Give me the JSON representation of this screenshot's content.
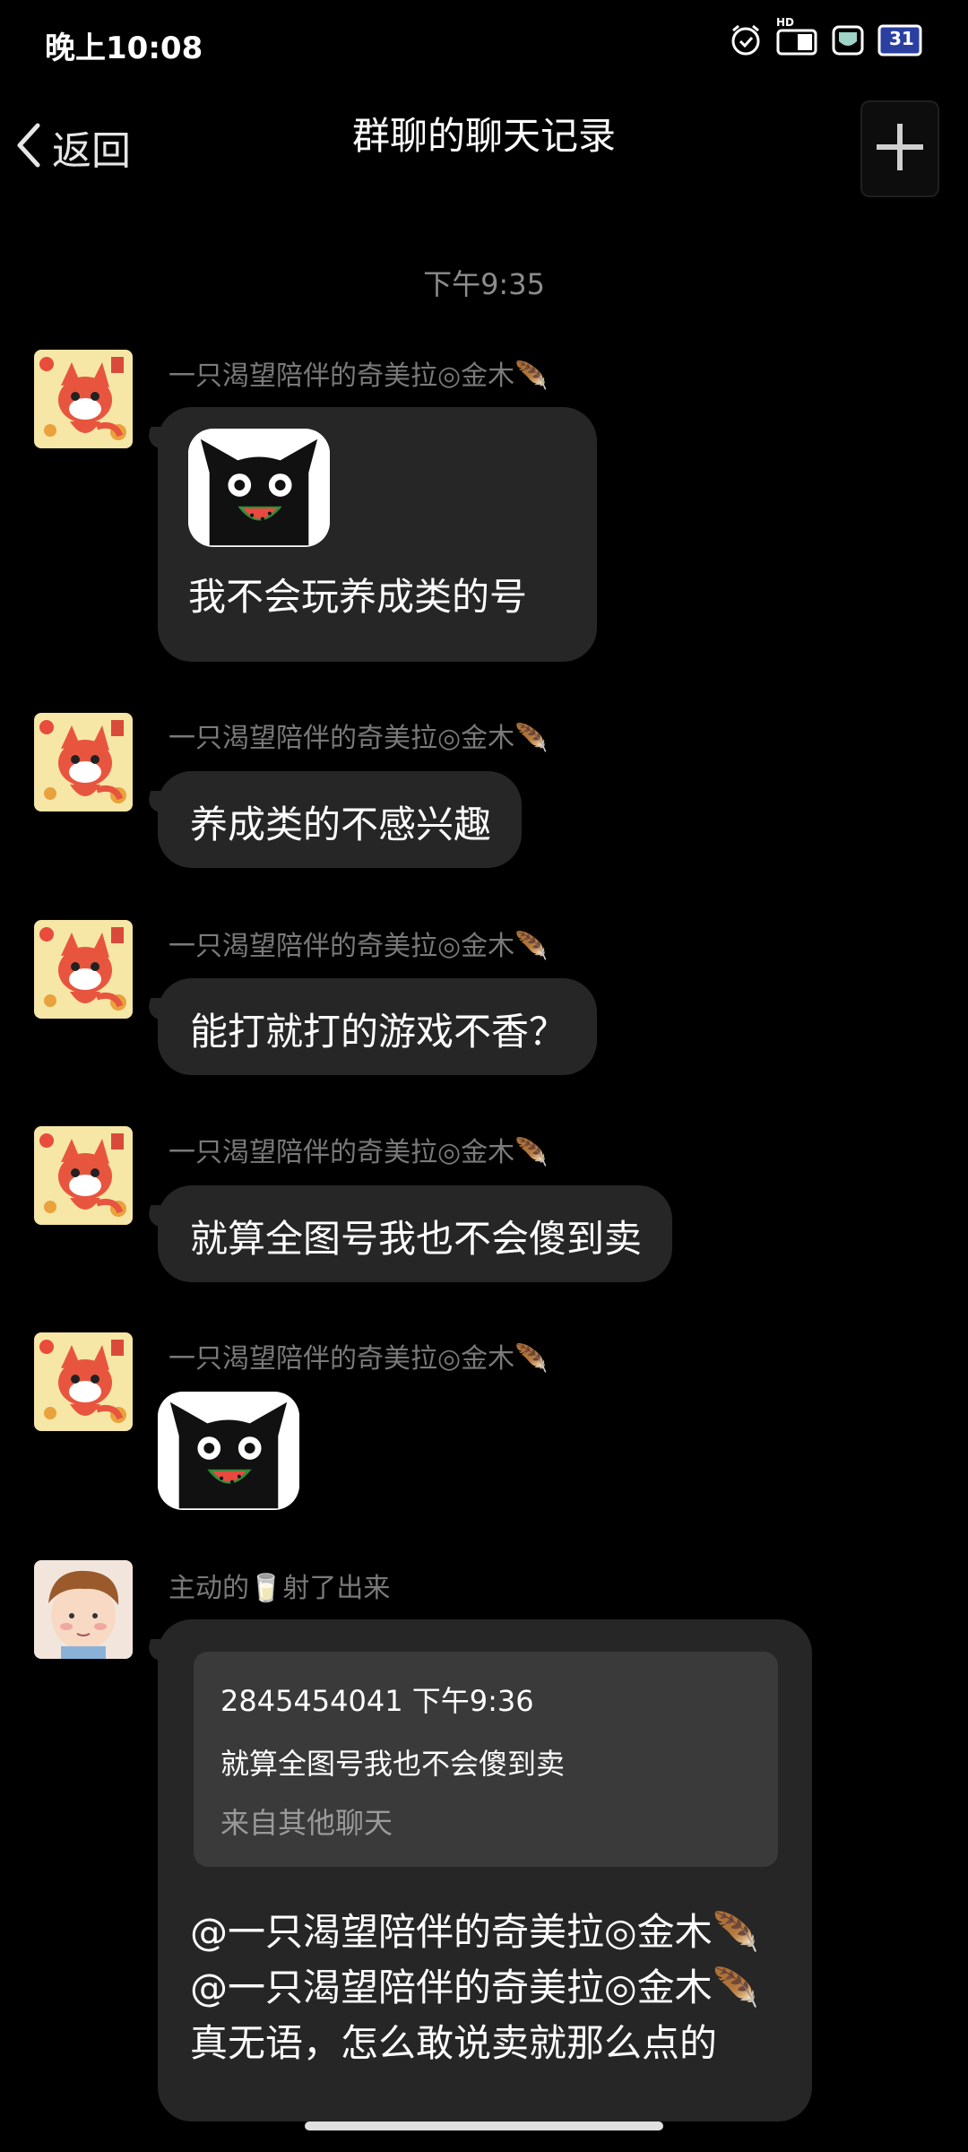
{
  "status_bar": {
    "time": "晚上10:08",
    "icons": [
      "alarm-icon",
      "hd-signal-icon",
      "shield-icon",
      "calendar-icon"
    ],
    "calendar_day": "31",
    "hd_label": "HD"
  },
  "header": {
    "back_label": "返回",
    "title": "群聊的聊天记录",
    "plus_icon": "plus-icon"
  },
  "timestamp": "下午9:35",
  "messages": [
    {
      "sender": "一只渴望陪伴的奇美拉◎金木🪶",
      "type": "sticker_text",
      "text": "我不会玩养成类的号"
    },
    {
      "sender": "一只渴望陪伴的奇美拉◎金木🪶",
      "type": "text",
      "text": "养成类的不感兴趣"
    },
    {
      "sender": "一只渴望陪伴的奇美拉◎金木🪶",
      "type": "text",
      "text": "能打就打的游戏不香？"
    },
    {
      "sender": "一只渴望陪伴的奇美拉◎金木🪶",
      "type": "text",
      "text": "就算全图号我也不会傻到卖"
    },
    {
      "sender": "一只渴望陪伴的奇美拉◎金木🪶",
      "type": "sticker"
    },
    {
      "sender": "主动的🥛射了出来",
      "type": "reply",
      "quote": {
        "header": "2845454041 下午9:36",
        "text": "就算全图号我也不会傻到卖",
        "source": "来自其他聊天"
      },
      "text": "@一只渴望陪伴的奇美拉◎金木🪶 @一只渴望陪伴的奇美拉◎金木🪶 真无语，怎么敢说卖就那么点的"
    }
  ],
  "colors": {
    "background": "#000000",
    "bubble": "#262626",
    "quote_box": "#3a3a3a",
    "sender_text": "#7a7a7a",
    "timestamp_text": "#8c8c8c"
  }
}
